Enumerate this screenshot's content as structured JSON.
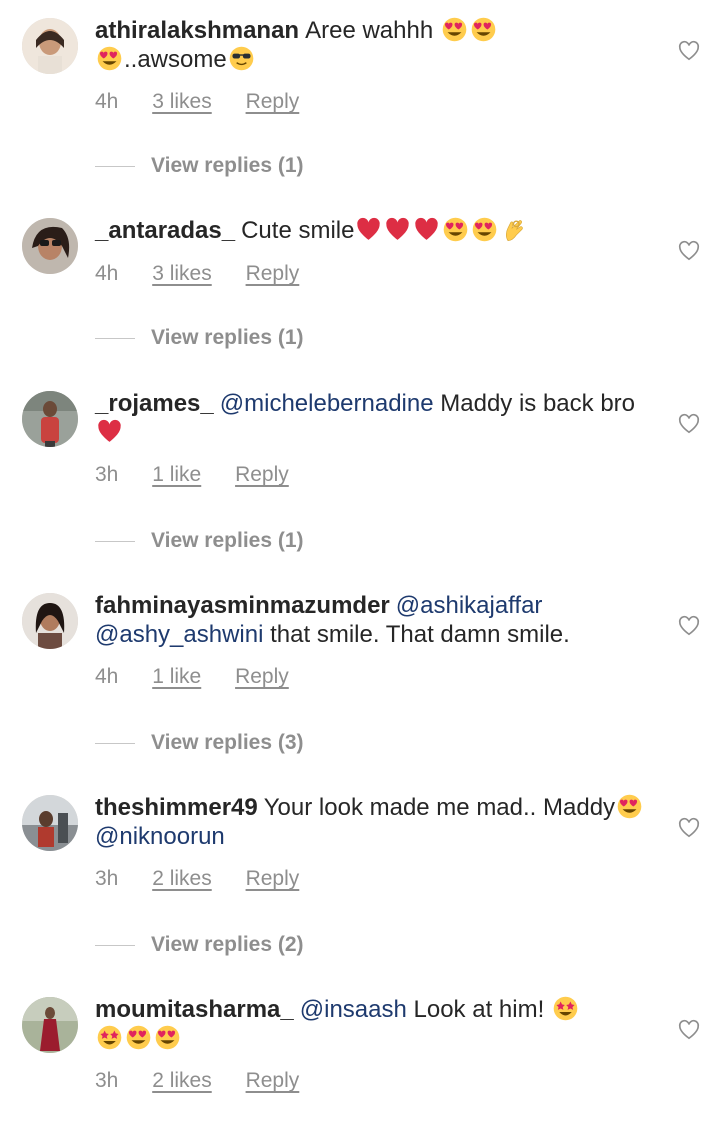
{
  "comments": [
    {
      "username": "athiralakshmanan",
      "time": "4h",
      "likes": "3 likes",
      "reply": "Reply",
      "view_replies": "View replies (1)",
      "text_a": "Aree wahhh",
      "text_b": "..awsome",
      "icons": [
        "heart-eyes-emoji",
        "heart-eyes-emoji",
        "heart-eyes-emoji",
        "sunglasses-emoji"
      ]
    },
    {
      "username": "_antaradas_",
      "time": "4h",
      "likes": "3 likes",
      "reply": "Reply",
      "view_replies": "View replies (1)",
      "text_a": "Cute smile",
      "icons": [
        "red-heart-emoji",
        "red-heart-emoji",
        "red-heart-emoji",
        "heart-eyes-emoji",
        "heart-eyes-emoji",
        "ok-hand-emoji"
      ]
    },
    {
      "username": "_rojames_",
      "time": "3h",
      "likes": "1 like",
      "reply": "Reply",
      "view_replies": "View replies (1)",
      "mention": "@michelebernadine",
      "text_a": "Maddy is back bro",
      "icons": [
        "red-heart-emoji"
      ]
    },
    {
      "username": "fahminayasminmazumder",
      "time": "4h",
      "likes": "1 like",
      "reply": "Reply",
      "view_replies": "View replies (3)",
      "mention": "@ashikajaffar",
      "mention2": "@ashy_ashwini",
      "text_a": "that smile. That damn smile."
    },
    {
      "username": "theshimmer49",
      "time": "3h",
      "likes": "2 likes",
      "reply": "Reply",
      "view_replies": "View replies (2)",
      "text_a": "Your look made me mad.. Maddy",
      "mention": "@niknoorun",
      "icons": [
        "heart-eyes-emoji"
      ]
    },
    {
      "username": "moumitasharma_",
      "time": "3h",
      "likes": "2 likes",
      "reply": "Reply",
      "mention": "@insaash",
      "text_a": "Look at him!",
      "icons": [
        "star-struck-emoji",
        "star-struck-emoji",
        "heart-eyes-emoji",
        "heart-eyes-emoji"
      ]
    }
  ],
  "colors": {
    "text": "#262626",
    "meta": "#8e8e8e",
    "mention": "#1e3a6e",
    "heart": "#e0245e",
    "emoji_face": "#ffcc4d"
  }
}
